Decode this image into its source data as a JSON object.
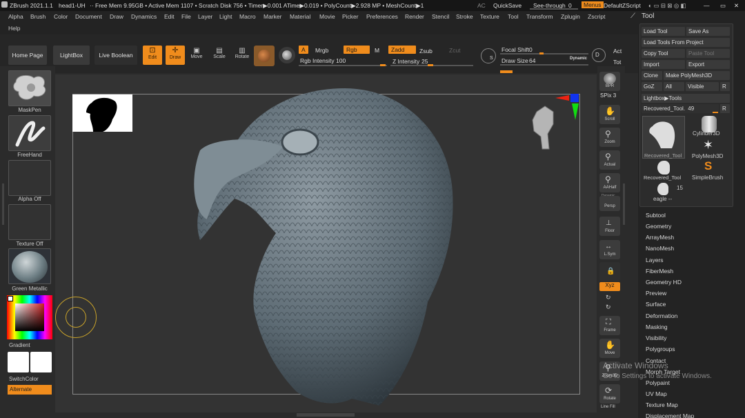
{
  "titlebar": {
    "app_version": "ZBrush 2021.1.1",
    "doc_name": "head1-UH",
    "stats": "·· Free Mem 9.95GB • Active Mem 1107 • Scratch Disk 756 • Timer▶0.001 ATime▶0.019 • PolyCount▶2.928 MP • MeshCount▶1",
    "ac": "AC",
    "quicksave": "QuickSave",
    "see_through": "See-through",
    "see_through_value": "0",
    "menus": "Menus",
    "default_script": "DefaultZScript"
  },
  "menubar": {
    "items": [
      "Alpha",
      "Brush",
      "Color",
      "Document",
      "Draw",
      "Dynamics",
      "Edit",
      "File",
      "Layer",
      "Light",
      "Macro",
      "Marker",
      "Material",
      "Movie",
      "Picker",
      "Preferences",
      "Render",
      "Stencil",
      "Stroke",
      "Texture",
      "Tool",
      "Transform",
      "Zplugin",
      "Zscript"
    ],
    "help": "Help"
  },
  "toolbar": {
    "home_page": "Home Page",
    "lightbox": "LightBox",
    "live_boolean": "Live Boolean",
    "edit": "Edit",
    "draw": "Draw",
    "move": "Move",
    "scale": "Scale",
    "rotate": "Rotate",
    "a": "A",
    "mrgb": "Mrgb",
    "rgb": "Rgb",
    "m": "M",
    "zadd": "Zadd",
    "zsub": "Zsub",
    "zcut": "Zcut",
    "rgb_intensity_label": "Rgb Intensity",
    "rgb_intensity_value": "100",
    "z_intensity_label": "Z Intensity",
    "z_intensity_value": "25",
    "focal_shift_label": "Focal Shift",
    "focal_shift_value": "0",
    "draw_size_label": "Draw Size",
    "draw_size_value": "64",
    "dynamic": "Dynamic",
    "act": "Act",
    "tot": "Tot",
    "s": "S",
    "d": "D"
  },
  "leftshelf": {
    "mask_pen": "MaskPen",
    "freehand": "FreeHand",
    "alpha_off": "Alpha Off",
    "texture_off": "Texture Off",
    "green_metallic": "Green Metallic",
    "gradient": "Gradient",
    "switch_color": "SwitchColor",
    "alternate": "Alternate"
  },
  "rightshelf": {
    "bpr": "BPR",
    "spix": "SPix",
    "spix_value": "3",
    "scroll": "Scroll",
    "zoom": "Zoom",
    "actual": "Actual",
    "aahalf": "AAHalf",
    "dynamic": "Dynamic",
    "persp": "Persp",
    "floor": "Floor",
    "lsym": "L.Sym",
    "xyz": "Xyz",
    "frame": "Frame",
    "move": "Move",
    "zoom3d": "Zoom3D",
    "rotate": "Rotate",
    "line_fill": "Line Fill"
  },
  "tool_palette": {
    "title": "Tool",
    "load_tool": "Load Tool",
    "save_as": "Save As",
    "load_tools_from_project": "Load Tools From Project",
    "copy_tool": "Copy Tool",
    "paste_tool": "Paste Tool",
    "import": "Import",
    "export": "Export",
    "clone": "Clone",
    "make_polymesh": "Make PolyMesh3D",
    "goz": "GoZ",
    "all": "All",
    "visible": "Visible",
    "r": "R",
    "lightbox_tools": "Lightbox▶Tools",
    "recovered_tool_slider": "Recovered_Tool.",
    "recovered_tool_value": "49",
    "thumbs": [
      {
        "label": "Recovered_Tool"
      },
      {
        "label": "Cylinder3D"
      },
      {
        "label": "PolyMesh3D"
      },
      {
        "label": "Recovered_Tool"
      },
      {
        "label": "SimpleBrush"
      },
      {
        "label": "eagle --"
      }
    ],
    "count_15": "15",
    "subpalettes": [
      "Subtool",
      "Geometry",
      "ArrayMesh",
      "NanoMesh",
      "Layers",
      "FiberMesh",
      "Geometry HD",
      "Preview",
      "Surface",
      "Deformation",
      "Masking",
      "Visibility",
      "Polygroups",
      "Contact",
      "Morph Target",
      "Polypaint",
      "UV Map",
      "Texture Map",
      "Displacement Map"
    ]
  },
  "watermark": {
    "line1": "Activate Windows",
    "line2": "Go to Settings to activate Windows."
  },
  "colors": {
    "accent": "#f08c1c",
    "panel": "#262626",
    "canvas": "#333333",
    "model": "#5f6f7a"
  }
}
